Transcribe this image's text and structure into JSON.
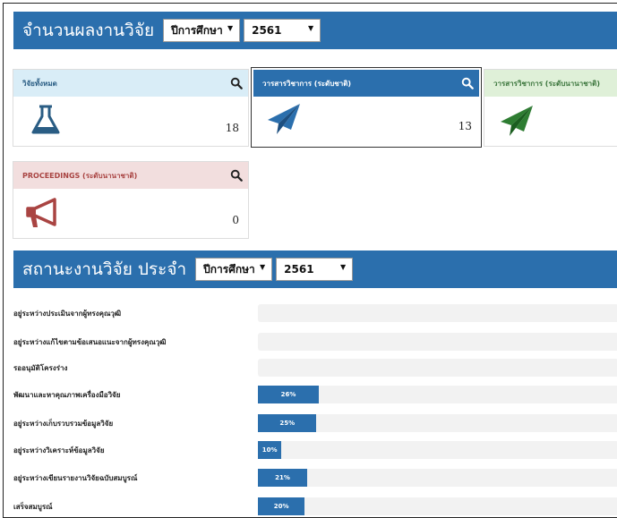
{
  "section1": {
    "title": "จำนวนผลงานวิจัย",
    "select_year_type": "ปีการศึกษา",
    "select_year": "2561"
  },
  "cards": [
    {
      "label": "วิจัยทั้งหมด",
      "count": "18",
      "icon": "flask-icon",
      "head_bg": "#d9edf7",
      "head_color": "#2a5d84"
    },
    {
      "label": "วารสารวิชาการ (ระดับชาติ)",
      "count": "13",
      "icon": "paper-plane-icon",
      "head_bg": "#2b6fad",
      "head_color": "#ffffff"
    },
    {
      "label": "วารสารวิชาการ (ระดับนานาชาติ)",
      "count": "",
      "icon": "paper-plane-icon",
      "head_bg": "#dff0d8",
      "head_color": "#3c763d"
    },
    {
      "label": "PROCEEDINGS (ระดับนานาชาติ)",
      "count": "0",
      "icon": "megaphone-icon",
      "head_bg": "#f2dede",
      "head_color": "#a94442"
    }
  ],
  "section2": {
    "title": "สถานะงานวิจัย ประจำ",
    "select_year_type": "ปีการศึกษา",
    "select_year": "2561"
  },
  "status_rows": [
    {
      "label": "อยู่ระหว่างประเมินจากผู้ทรงคุณวุฒิ",
      "percent": 0,
      "text": ""
    },
    {
      "label": "อยู่ระหว่างแก้ไขตามข้อเสนอแนะจากผู้ทรงคุณวุฒิ",
      "percent": 0,
      "text": ""
    },
    {
      "label": "รออนุมัติโครงร่าง",
      "percent": 0,
      "text": ""
    },
    {
      "label": "พัฒนาและหาคุณภาพเครื่องมือวิจัย",
      "percent": 26,
      "text": "26%"
    },
    {
      "label": "อยู่ระหว่างเก็บรวบรวมข้อมูลวิจัย",
      "percent": 25,
      "text": "25%"
    },
    {
      "label": "อยู่ระหว่างวิเคราะห์ข้อมูลวิจัย",
      "percent": 10,
      "text": "10%"
    },
    {
      "label": "อยู่ระหว่างเขียนรายงานวิจัยฉบับสมบูรณ์",
      "percent": 21,
      "text": "21%"
    },
    {
      "label": "เสร็จสมบูรณ์",
      "percent": 20,
      "text": "20%"
    }
  ],
  "colors": {
    "accent": "#2b6fad",
    "flask": "#2a5d84",
    "plane_blue": "#2b6fad",
    "plane_green": "#2e7d32",
    "megaphone": "#a94442"
  }
}
